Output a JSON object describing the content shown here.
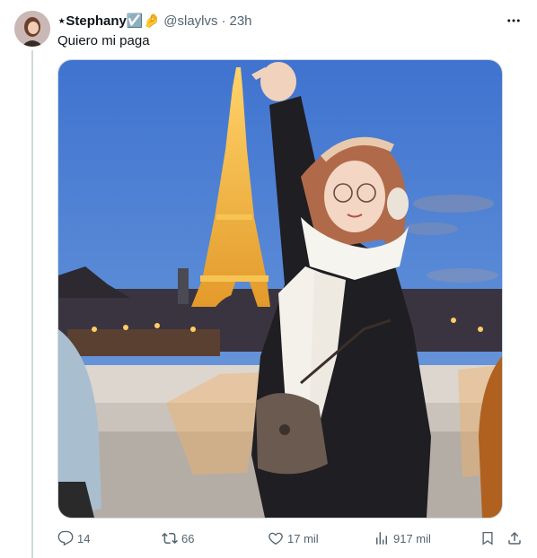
{
  "tweet": {
    "display_name": "⋆Stephany☑️🤌",
    "handle": "@slaylvs",
    "separator": "·",
    "time": "23h",
    "text": "Quiero mi paga"
  },
  "actions": {
    "reply_count": "14",
    "retweet_count": "66",
    "like_count": "17 mil",
    "views_count": "917 mil"
  },
  "icons": [
    "more-icon",
    "reply-icon",
    "retweet-icon",
    "like-icon",
    "views-icon",
    "bookmark-icon",
    "share-icon"
  ],
  "colors": {
    "text": "#0f1419",
    "secondary": "#536471",
    "border": "#cfd9de"
  }
}
